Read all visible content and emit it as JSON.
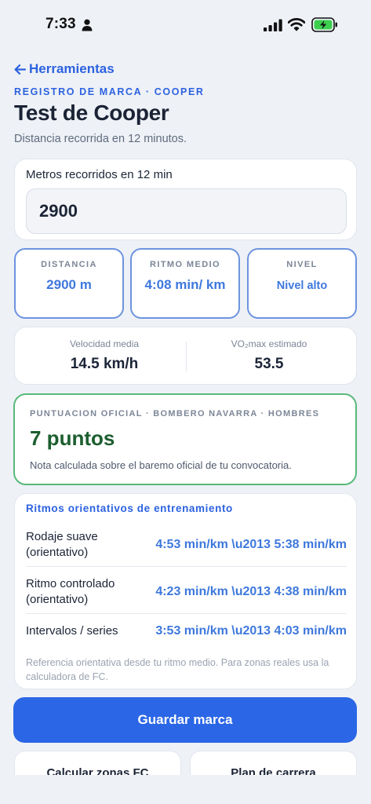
{
  "status_bar": {
    "time": "7:33",
    "icons": [
      "person-icon",
      "signal-icon",
      "wifi-icon",
      "battery-charging-icon"
    ]
  },
  "nav": {
    "back_label": "Herramientas",
    "back_icon": "arrow-left-icon"
  },
  "header": {
    "eyebrow": "REGISTRO DE MARCA · COOPER",
    "title": "Test de Cooper",
    "subtitle": "Distancia recorrida en 12 minutos."
  },
  "input": {
    "label": "Metros recorridos en 12 min",
    "value": "2900"
  },
  "metrics": [
    {
      "label": "DISTANCIA",
      "value": "2900 m"
    },
    {
      "label": "RITMO MEDIO",
      "value": "4:08 min/ km"
    },
    {
      "label": "NIVEL",
      "value": "Nivel alto"
    }
  ],
  "stats": [
    {
      "label": "Velocidad media",
      "value": "14.5 km/h"
    },
    {
      "label": "VO₂max estimado",
      "value": "53.5"
    }
  ],
  "score": {
    "eyebrow": "PUNTUACION OFICIAL · BOMBERO NAVARRA · HOMBRES",
    "value": "7 puntos",
    "note": "Nota calculada sobre el baremo oficial de tu convocatoria."
  },
  "paces": {
    "title": "Ritmos orientativos de entrenamiento",
    "rows": [
      {
        "name": "Rodaje suave (orientativo)",
        "range": "4:53 min/km \\u2013 5:38 min/km"
      },
      {
        "name": "Ritmo controlado (orientativo)",
        "range": "4:23 min/km \\u2013 4:38 min/km"
      },
      {
        "name": "Intervalos / series",
        "range": "3:53 min/km \\u2013 4:03 min/km"
      }
    ],
    "footnote": "Referencia orientativa desde tu ritmo medio. Para zonas reales usa la calculadora de FC."
  },
  "actions": {
    "save": "Guardar marca",
    "secondary": [
      "Calcular zonas FC",
      "Plan de carrera"
    ]
  },
  "colors": {
    "accent": "#2a66e6",
    "score_border": "#58b97a",
    "score_text": "#1c5e2f",
    "metric_border": "#6d94df"
  }
}
